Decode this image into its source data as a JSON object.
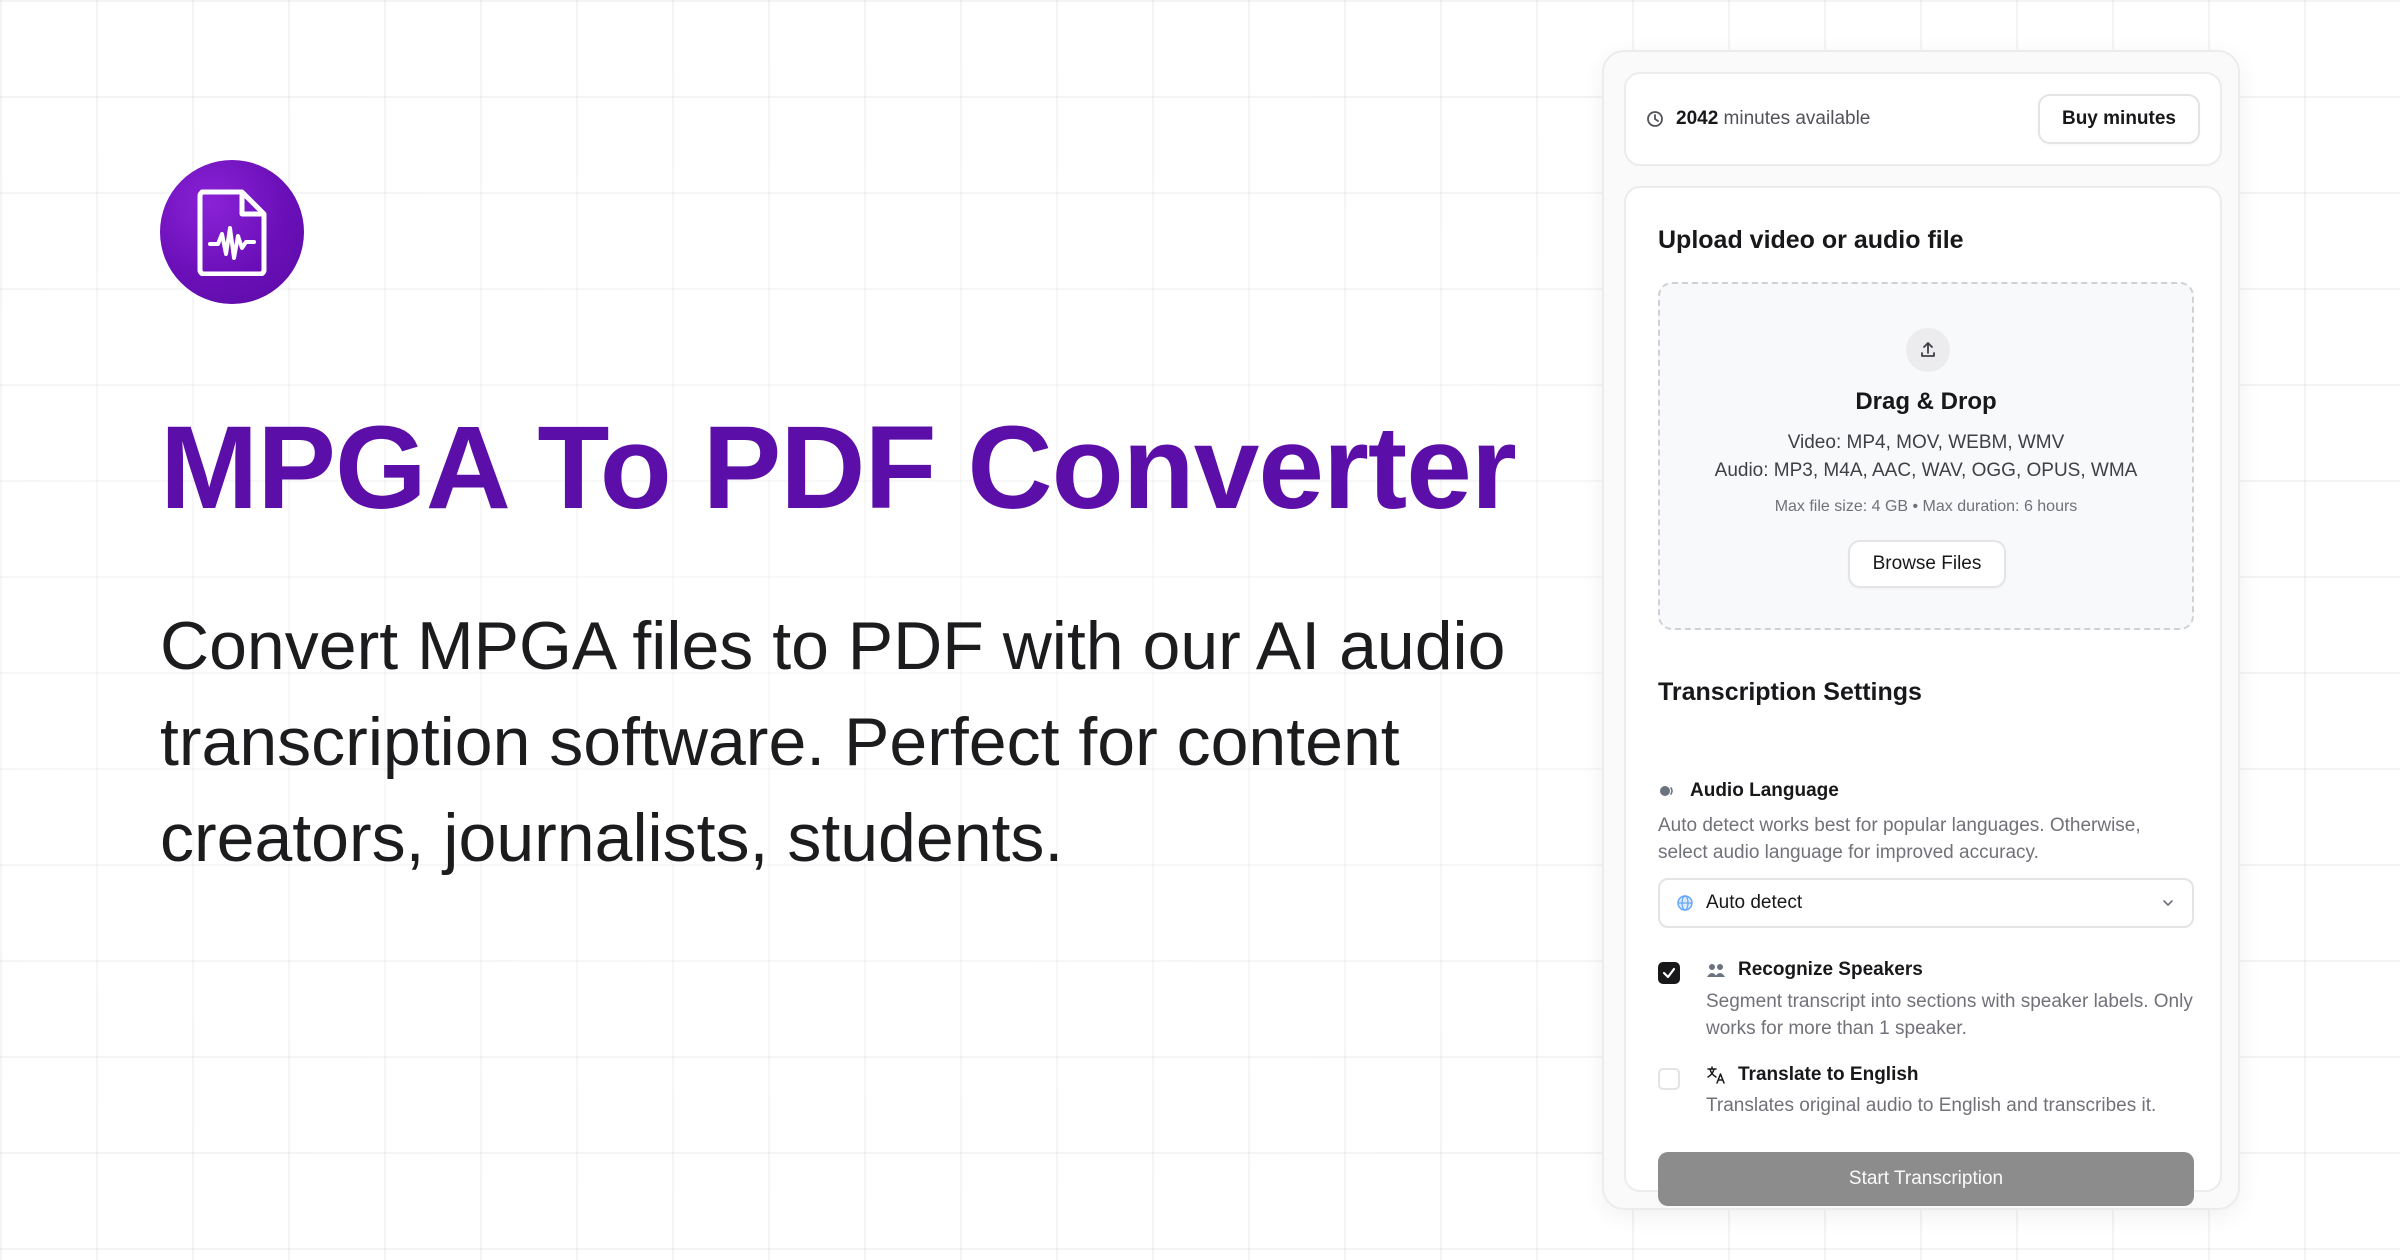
{
  "hero": {
    "title": "MPGA To PDF Converter",
    "description": "Convert MPGA files to PDF with our AI audio transcription software. Perfect for content creators, journalists, students.",
    "logo_icon": "audio-file-icon"
  },
  "minutes": {
    "count": "2042",
    "suffix": " minutes available",
    "buy_label": "Buy minutes"
  },
  "upload": {
    "title": "Upload video or audio file",
    "drop_title": "Drag & Drop",
    "video_formats": "Video: MP4, MOV, WEBM, WMV",
    "audio_formats": "Audio: MP3, M4A, AAC, WAV, OGG, OPUS, WMA",
    "limits": "Max file size: 4 GB • Max duration: 6 hours",
    "browse_label": "Browse Files"
  },
  "settings": {
    "title": "Transcription Settings",
    "language": {
      "label": "Audio Language",
      "help": "Auto detect works best for popular languages. Otherwise, select audio language for improved accuracy.",
      "selected": "Auto detect"
    },
    "speakers": {
      "label": "Recognize Speakers",
      "help": "Segment transcript into sections with speaker labels. Only works for more than 1 speaker.",
      "checked": true
    },
    "translate": {
      "label": "Translate to English",
      "help": "Translates original audio to English and transcribes it.",
      "checked": false
    },
    "start_label": "Start Transcription"
  },
  "colors": {
    "brand": "#5b0fa8",
    "start_button_disabled": "#8c8c8c"
  }
}
